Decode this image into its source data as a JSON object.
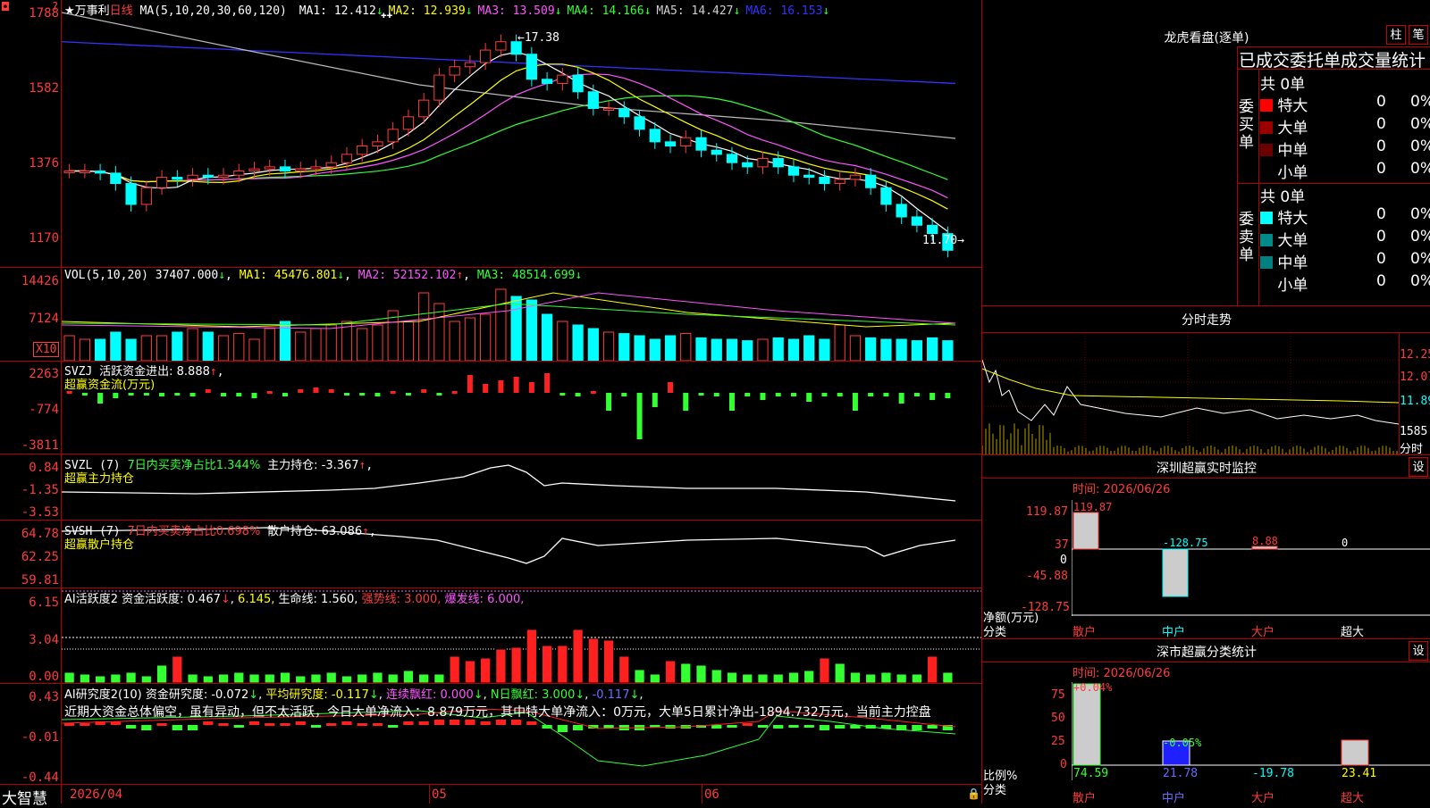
{
  "header": {
    "stock_name": "★万事利",
    "period": "日线",
    "ma_label": "MA(5,10,20,30,60,120)",
    "ma": [
      {
        "name": "MA1",
        "value": "12.412",
        "dir": "↓",
        "color": "#ffffff"
      },
      {
        "name": "MA2",
        "value": "12.939",
        "dir": "↓",
        "color": "#ffff00"
      },
      {
        "name": "MA3",
        "value": "13.509",
        "dir": "↓",
        "color": "#ff55ff"
      },
      {
        "name": "MA4",
        "value": "14.166",
        "dir": "↓",
        "color": "#33ff33"
      },
      {
        "name": "MA5",
        "value": "14.427",
        "dir": "↓",
        "color": "#cfcfcf"
      },
      {
        "name": "MA6",
        "value": "16.153",
        "dir": "↓",
        "color": "#3333ff"
      }
    ],
    "high_mark": "17.38",
    "low_mark": "11.70"
  },
  "price_axis": [
    "1788",
    "1582",
    "1376",
    "1170"
  ],
  "volume": {
    "label": "VOL(5,10,20)",
    "value": "37407.000",
    "ma1": "MA1: 45476.801",
    "ma2": "MA2: 52152.102",
    "ma3": "MA3: 48514.699",
    "axis": [
      "14426",
      "7124"
    ],
    "unit": "X10"
  },
  "svzj": {
    "label": "SVZJ",
    "text": "活跃资金进出: 8.888",
    "subtitle": "超赢资金流(万元)",
    "axis": [
      "2263",
      "-774",
      "-3811"
    ]
  },
  "svzl": {
    "label": "SVZL (7)",
    "ratio": "7日内买卖净占比1.344%",
    "hold": "主力持仓: -3.367",
    "subtitle": "超赢主力持仓",
    "axis": [
      "0.84",
      "-1.35",
      "-3.53"
    ]
  },
  "svsh": {
    "label": "SVSH (7)",
    "ratio": "7日内买卖净占比0.698%",
    "hold": "散户持仓: 63.086",
    "subtitle": "超赢散户持仓",
    "axis": [
      "64.78",
      "62.25",
      "59.81"
    ]
  },
  "ai_active": {
    "label": "AI活跃度2",
    "t1": "资金活跃度: 0.467",
    "t2": "6.145,",
    "t3": "生命线: 1.560,",
    "t4": "强势线: 3.000,",
    "t5": "爆发线: 6.000,",
    "axis": [
      "6.15",
      "3.04",
      "0.00"
    ]
  },
  "ai_research": {
    "label": "AI研究度2(10)",
    "t1": "资金研究度: -0.072",
    "t2": "平均研究度: -0.117",
    "t3": "连续飘红: 0.000",
    "t4": "N日飘红: 3.000",
    "t5": "-0.117",
    "summary": "近期大资金总体偏空，虽有异动，但不太活跃，今日大单净流入：8.879万元，其中特大单净流入：0万元，大单5日累计净出-1894.732万元，当前主力控盘",
    "axis": [
      "0.43",
      "-0.01",
      "-0.44"
    ]
  },
  "date_axis": {
    "d1": "2026/04",
    "d2": "05",
    "d3": "06"
  },
  "brand": "大智慧",
  "dragon_tiger": {
    "title": "龙虎看盘(逐单)",
    "btn1": "柱",
    "btn2": "笔",
    "header": "已成交委托单成交量统计",
    "buy_label": "委买单",
    "sell_label": "委卖单",
    "buy_total": "共 0单",
    "sell_total": "共 0单",
    "buy_rows": [
      {
        "label": "特大",
        "count": "0",
        "pct": "0%",
        "color": "#ff0000"
      },
      {
        "label": "大单",
        "count": "0",
        "pct": "0%",
        "color": "#9b0000"
      },
      {
        "label": "中单",
        "count": "0",
        "pct": "0%",
        "color": "#6b0000"
      },
      {
        "label": "小单",
        "count": "0",
        "pct": "0%",
        "color": "#000000"
      }
    ],
    "sell_rows": [
      {
        "label": "特大",
        "count": "0",
        "pct": "0%",
        "color": "#00ffff"
      },
      {
        "label": "大单",
        "count": "0",
        "pct": "0%",
        "color": "#008b8b"
      },
      {
        "label": "中单",
        "count": "0",
        "pct": "0%",
        "color": "#008080"
      },
      {
        "label": "小单",
        "count": "0",
        "pct": "0%",
        "color": "#000000"
      }
    ]
  },
  "intraday": {
    "title": "分时走势",
    "axis": [
      "12.25",
      "12.07",
      "11.89",
      "1585"
    ],
    "unit": "分时"
  },
  "sz_monitor": {
    "title": "深圳超赢实时监控",
    "btn": "设",
    "time": "时间: 2026/06/26",
    "axis": [
      "119.87",
      "37",
      "0",
      "-45.88",
      "-128.75"
    ],
    "ylabel": "净额(万元)",
    "xlabel": "分类",
    "values": [
      "119.87",
      "-128.75",
      "8.88",
      "0"
    ],
    "categories": [
      "散户",
      "中户",
      "大户",
      "超大"
    ]
  },
  "sz_class": {
    "title": "深市超赢分类统计",
    "btn": "设",
    "time": "时间: 2026/06/26",
    "axis": [
      "75",
      "50",
      "25",
      "0"
    ],
    "ylabel": "比例%",
    "xlabel": "分类",
    "tops": [
      "+0.04%",
      "-0.05%"
    ],
    "values": [
      "74.59",
      "21.78",
      "-19.78",
      "23.41"
    ],
    "categories": [
      "散户",
      "中户",
      "大户",
      "超大"
    ]
  }
}
